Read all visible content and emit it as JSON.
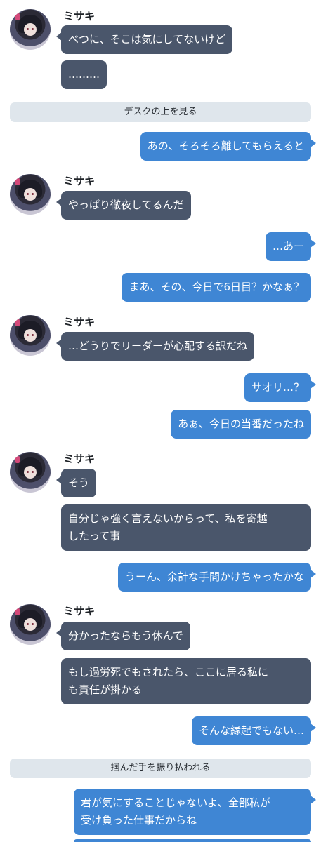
{
  "character": {
    "name": "ミサキ"
  },
  "messages": {
    "m1": "べつに、そこは気にしてないけど",
    "m2": "………",
    "n1": "デスクの上を見る",
    "m3": "あの、そろそろ離してもらえると",
    "m4": "やっぱり徹夜してるんだ",
    "m5": "…あー",
    "m6": "まあ、その、今日で6日目？かなぁ？",
    "m7": "…どうりでリーダーが心配する訳だね",
    "m8": "サオリ…？",
    "m9": "あぁ、今日の当番だったね",
    "m10": "そう",
    "m11a": "自分じゃ強く言えないからって、私を寄越",
    "m11b": "したって事",
    "m12": "うーん、余計な手間かけちゃったかな",
    "m13": "分かったならもう休んで",
    "m14a": "もし過労死でもされたら、ここに居る私に",
    "m14b": "も責任が掛かる",
    "m15": "そんな縁起でもない…",
    "n2": "掴んだ手を振り払われる",
    "m16a": "君が気にすることじゃないよ、全部私が",
    "m16b": "受け負った仕事だからね"
  }
}
